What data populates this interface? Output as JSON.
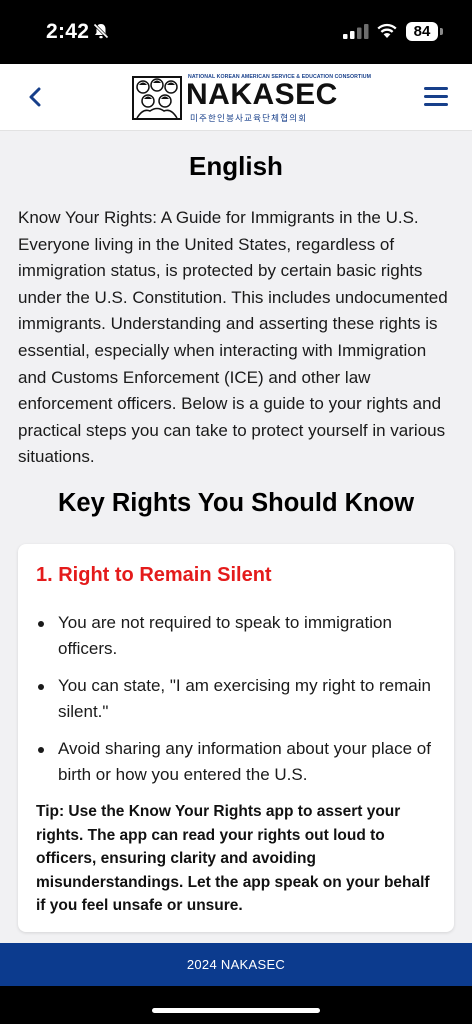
{
  "status_bar": {
    "time": "2:42",
    "battery": "84",
    "icons": [
      "bell-slash-icon",
      "cellular-signal-icon",
      "wifi-icon",
      "battery-icon"
    ]
  },
  "header": {
    "back_icon": "chevron-left-icon",
    "menu_icon": "hamburger-menu-icon",
    "logo": {
      "tagline": "NATIONAL KOREAN AMERICAN SERVICE & EDUCATION CONSORTIUM",
      "name": "NAKASEC",
      "korean": "미주한인봉사교육단체협의회"
    }
  },
  "page": {
    "title": "English",
    "intro": "Know Your Rights: A Guide for Immigrants in the U.S. Everyone living in the United States, regardless of immigration status, is protected by certain basic rights under the U.S. Constitution. This includes undocumented immigrants. Understanding and asserting these rights is essential, especially when interacting with Immigration and Customs Enforcement (ICE) and other law enforcement officers. Below is a guide to your rights and practical steps you can take to protect yourself in various situations.",
    "section_title": "Key Rights You Should Know"
  },
  "card": {
    "title": "1. Right to Remain Silent",
    "items": [
      "You are not required to speak to immigration officers.",
      "You can state, \"I am exercising my right to remain silent.\"",
      "Avoid sharing any information about your place of birth or how you entered the U.S."
    ],
    "tip": "Tip: Use the Know Your Rights app to assert your rights. The app can read your rights out loud to officers, ensuring clarity and avoiding misunderstandings. Let the app speak on your behalf if you feel unsafe or unsure."
  },
  "footer": {
    "text": "2024 NAKASEC"
  },
  "colors": {
    "brand_blue": "#0c3b8e",
    "accent_red": "#e41b1b",
    "background": "#f1f1f3"
  }
}
